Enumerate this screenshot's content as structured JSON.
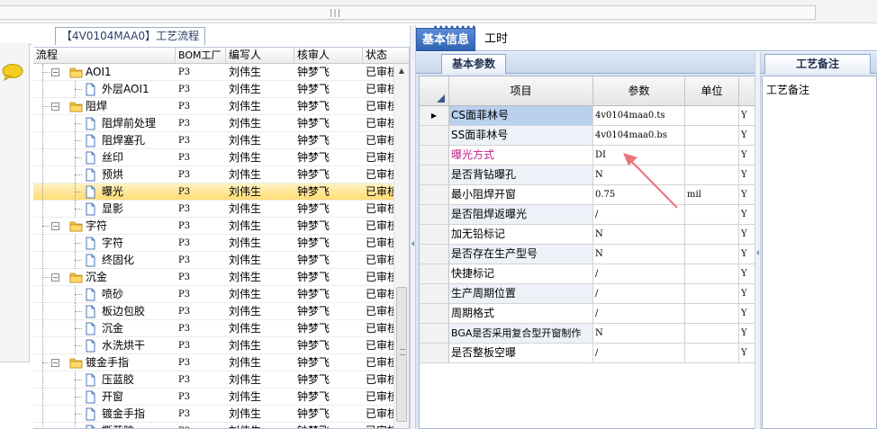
{
  "tree": {
    "tab_title": "【4V0104MAA0】工艺流程",
    "columns": [
      "流程",
      "BOM工厂",
      "编写人",
      "核审人",
      "状态"
    ],
    "rows": [
      {
        "name": "AOI1",
        "type": "folder",
        "level": 1,
        "expanded": true,
        "bom": "P3",
        "author": "刘伟生",
        "reviewer": "钟梦飞",
        "status": "已审核"
      },
      {
        "name": "外层AOI1",
        "type": "doc",
        "level": 2,
        "bom": "P3",
        "author": "刘伟生",
        "reviewer": "钟梦飞",
        "status": "已审核"
      },
      {
        "name": "阻焊",
        "type": "folder",
        "level": 1,
        "expanded": true,
        "bom": "P3",
        "author": "刘伟生",
        "reviewer": "钟梦飞",
        "status": "已审核"
      },
      {
        "name": "阻焊前处理",
        "type": "doc",
        "level": 2,
        "bom": "P3",
        "author": "刘伟生",
        "reviewer": "钟梦飞",
        "status": "已审核"
      },
      {
        "name": "阻焊塞孔",
        "type": "doc",
        "level": 2,
        "bom": "P3",
        "author": "刘伟生",
        "reviewer": "钟梦飞",
        "status": "已审核"
      },
      {
        "name": "丝印",
        "type": "doc",
        "level": 2,
        "bom": "P3",
        "author": "刘伟生",
        "reviewer": "钟梦飞",
        "status": "已审核"
      },
      {
        "name": "预烘",
        "type": "doc",
        "level": 2,
        "bom": "P3",
        "author": "刘伟生",
        "reviewer": "钟梦飞",
        "status": "已审核"
      },
      {
        "name": "曝光",
        "type": "doc",
        "level": 2,
        "selected": true,
        "bom": "P3",
        "author": "刘伟生",
        "reviewer": "钟梦飞",
        "status": "已审核"
      },
      {
        "name": "显影",
        "type": "doc",
        "level": 2,
        "bom": "P3",
        "author": "刘伟生",
        "reviewer": "钟梦飞",
        "status": "已审核"
      },
      {
        "name": "字符",
        "type": "folder",
        "level": 1,
        "expanded": true,
        "bom": "P3",
        "author": "刘伟生",
        "reviewer": "钟梦飞",
        "status": "已审核"
      },
      {
        "name": "字符",
        "type": "doc",
        "level": 2,
        "bom": "P3",
        "author": "刘伟生",
        "reviewer": "钟梦飞",
        "status": "已审核"
      },
      {
        "name": "终固化",
        "type": "doc",
        "level": 2,
        "bom": "P3",
        "author": "刘伟生",
        "reviewer": "钟梦飞",
        "status": "已审核"
      },
      {
        "name": "沉金",
        "type": "folder",
        "level": 1,
        "expanded": true,
        "bom": "P3",
        "author": "刘伟生",
        "reviewer": "钟梦飞",
        "status": "已审核"
      },
      {
        "name": "喷砂",
        "type": "doc",
        "level": 2,
        "bom": "P3",
        "author": "刘伟生",
        "reviewer": "钟梦飞",
        "status": "已审核"
      },
      {
        "name": "板边包胶",
        "type": "doc",
        "level": 2,
        "bom": "P3",
        "author": "刘伟生",
        "reviewer": "钟梦飞",
        "status": "已审核"
      },
      {
        "name": "沉金",
        "type": "doc",
        "level": 2,
        "bom": "P3",
        "author": "刘伟生",
        "reviewer": "钟梦飞",
        "status": "已审核"
      },
      {
        "name": "水洗烘干",
        "type": "doc",
        "level": 2,
        "bom": "P3",
        "author": "刘伟生",
        "reviewer": "钟梦飞",
        "status": "已审核"
      },
      {
        "name": "镀金手指",
        "type": "folder",
        "level": 1,
        "expanded": true,
        "bom": "P3",
        "author": "刘伟生",
        "reviewer": "钟梦飞",
        "status": "已审核"
      },
      {
        "name": "压蓝胶",
        "type": "doc",
        "level": 2,
        "bom": "P3",
        "author": "刘伟生",
        "reviewer": "钟梦飞",
        "status": "已审核"
      },
      {
        "name": "开窗",
        "type": "doc",
        "level": 2,
        "bom": "P3",
        "author": "刘伟生",
        "reviewer": "钟梦飞",
        "status": "已审核"
      },
      {
        "name": "镀金手指",
        "type": "doc",
        "level": 2,
        "bom": "P3",
        "author": "刘伟生",
        "reviewer": "钟梦飞",
        "status": "已审核"
      },
      {
        "name": "撕蓝胶",
        "type": "doc",
        "level": 2,
        "bom": "P3",
        "author": "刘伟生",
        "reviewer": "钟梦飞",
        "status": "已审核"
      }
    ]
  },
  "top_tabs": [
    {
      "label": "基本信息",
      "active": true
    },
    {
      "label": "工时",
      "active": false
    }
  ],
  "params": {
    "tab_label": "基本参数",
    "columns": [
      "项目",
      "参数",
      "单位",
      ""
    ],
    "rows": [
      {
        "name": "CS面菲林号",
        "value": "4v0104maa0.ts",
        "unit": "",
        "flag": "Y",
        "current": true,
        "highlight": true
      },
      {
        "name": "SS面菲林号",
        "value": "4v0104maa0.bs",
        "unit": "",
        "flag": "Y"
      },
      {
        "name": "曝光方式",
        "value": "DI",
        "unit": "",
        "flag": "Y",
        "name_color": "#c0238a"
      },
      {
        "name": "是否背钻曝孔",
        "value": "N",
        "unit": "",
        "flag": "Y"
      },
      {
        "name": "最小阻焊开窗",
        "value": "0.75",
        "unit": "mil",
        "flag": "Y"
      },
      {
        "name": "是否阻焊返曝光",
        "value": "/",
        "unit": "",
        "flag": "Y"
      },
      {
        "name": "加无铅标记",
        "value": "N",
        "unit": "",
        "flag": "Y"
      },
      {
        "name": "是否存在生产型号",
        "value": "N",
        "unit": "",
        "flag": "Y"
      },
      {
        "name": "快捷标记",
        "value": "/",
        "unit": "",
        "flag": "Y"
      },
      {
        "name": "生产周期位置",
        "value": "/",
        "unit": "",
        "flag": "Y"
      },
      {
        "name": "周期格式",
        "value": "/",
        "unit": "",
        "flag": "Y"
      },
      {
        "name": "BGA是否采用复合型开窗制作",
        "value": "N",
        "unit": "",
        "flag": "Y"
      },
      {
        "name": "是否整板空曝",
        "value": "/",
        "unit": "",
        "flag": "Y"
      }
    ]
  },
  "notes": {
    "tab_label": "工艺备注",
    "label": "工艺备注"
  },
  "colors": {
    "accent": "#2f62b2",
    "selection": "#ffdc73",
    "annotation_arrow": "#e8747c"
  },
  "icons": [
    "chat-bubble-icon",
    "folder-icon",
    "document-icon",
    "current-row-icon",
    "sort-icon"
  ]
}
